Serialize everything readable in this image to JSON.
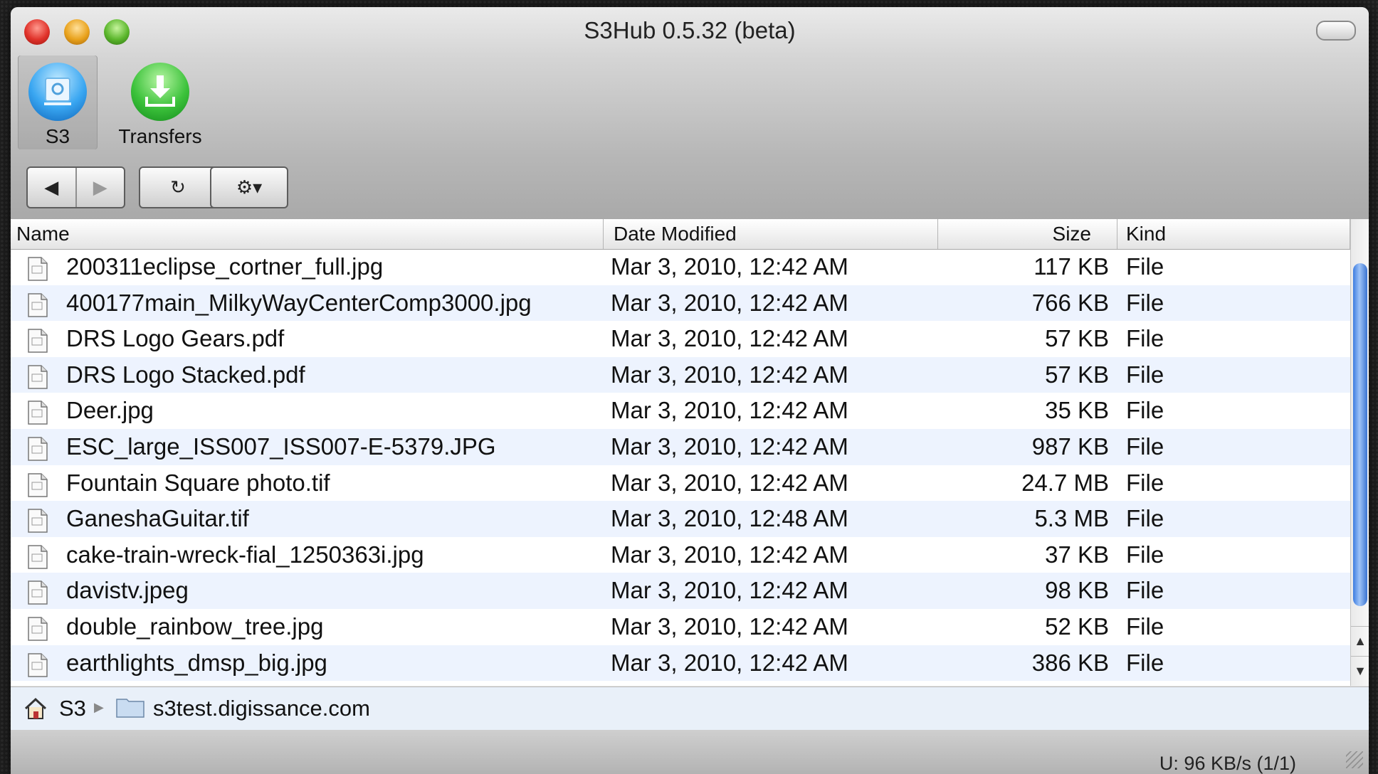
{
  "window": {
    "title": "S3Hub 0.5.32 (beta)"
  },
  "toolbar": {
    "items": [
      {
        "label": "S3",
        "icon": "drive-icon"
      },
      {
        "label": "Transfers",
        "icon": "download-icon"
      }
    ],
    "back_symbol": "◀",
    "forward_symbol": "▶",
    "refresh_symbol": "↻",
    "gear_symbol": "⚙▾"
  },
  "table": {
    "columns": [
      "Name",
      "Date Modified",
      "Size",
      "Kind"
    ],
    "rows": [
      {
        "name": "200311eclipse_cortner_full.jpg",
        "date": "Mar 3, 2010, 12:42 AM",
        "size": "117 KB",
        "kind": "File"
      },
      {
        "name": "400177main_MilkyWayCenterComp3000.jpg",
        "date": "Mar 3, 2010, 12:42 AM",
        "size": "766 KB",
        "kind": "File"
      },
      {
        "name": "DRS Logo Gears.pdf",
        "date": "Mar 3, 2010, 12:42 AM",
        "size": "57 KB",
        "kind": "File"
      },
      {
        "name": "DRS Logo Stacked.pdf",
        "date": "Mar 3, 2010, 12:42 AM",
        "size": "57 KB",
        "kind": "File"
      },
      {
        "name": "Deer.jpg",
        "date": "Mar 3, 2010, 12:42 AM",
        "size": "35 KB",
        "kind": "File"
      },
      {
        "name": "ESC_large_ISS007_ISS007-E-5379.JPG",
        "date": "Mar 3, 2010, 12:42 AM",
        "size": "987 KB",
        "kind": "File"
      },
      {
        "name": "Fountain Square photo.tif",
        "date": "Mar 3, 2010, 12:42 AM",
        "size": "24.7 MB",
        "kind": "File"
      },
      {
        "name": "GaneshaGuitar.tif",
        "date": "Mar 3, 2010, 12:48 AM",
        "size": "5.3 MB",
        "kind": "File"
      },
      {
        "name": "cake-train-wreck-fial_1250363i.jpg",
        "date": "Mar 3, 2010, 12:42 AM",
        "size": "37 KB",
        "kind": "File"
      },
      {
        "name": "davistv.jpeg",
        "date": "Mar 3, 2010, 12:42 AM",
        "size": "98 KB",
        "kind": "File"
      },
      {
        "name": "double_rainbow_tree.jpg",
        "date": "Mar 3, 2010, 12:42 AM",
        "size": "52 KB",
        "kind": "File"
      },
      {
        "name": "earthlights_dmsp_big.jpg",
        "date": "Mar 3, 2010, 12:42 AM",
        "size": "386 KB",
        "kind": "File"
      }
    ]
  },
  "path": {
    "root": "S3",
    "bucket": "s3test.digissance.com"
  },
  "status": {
    "rate": "U: 96 KB/s (1/1)"
  },
  "colors": {
    "row_alt": "#edf3fe",
    "scroll_thumb": "#3d7ce0"
  }
}
